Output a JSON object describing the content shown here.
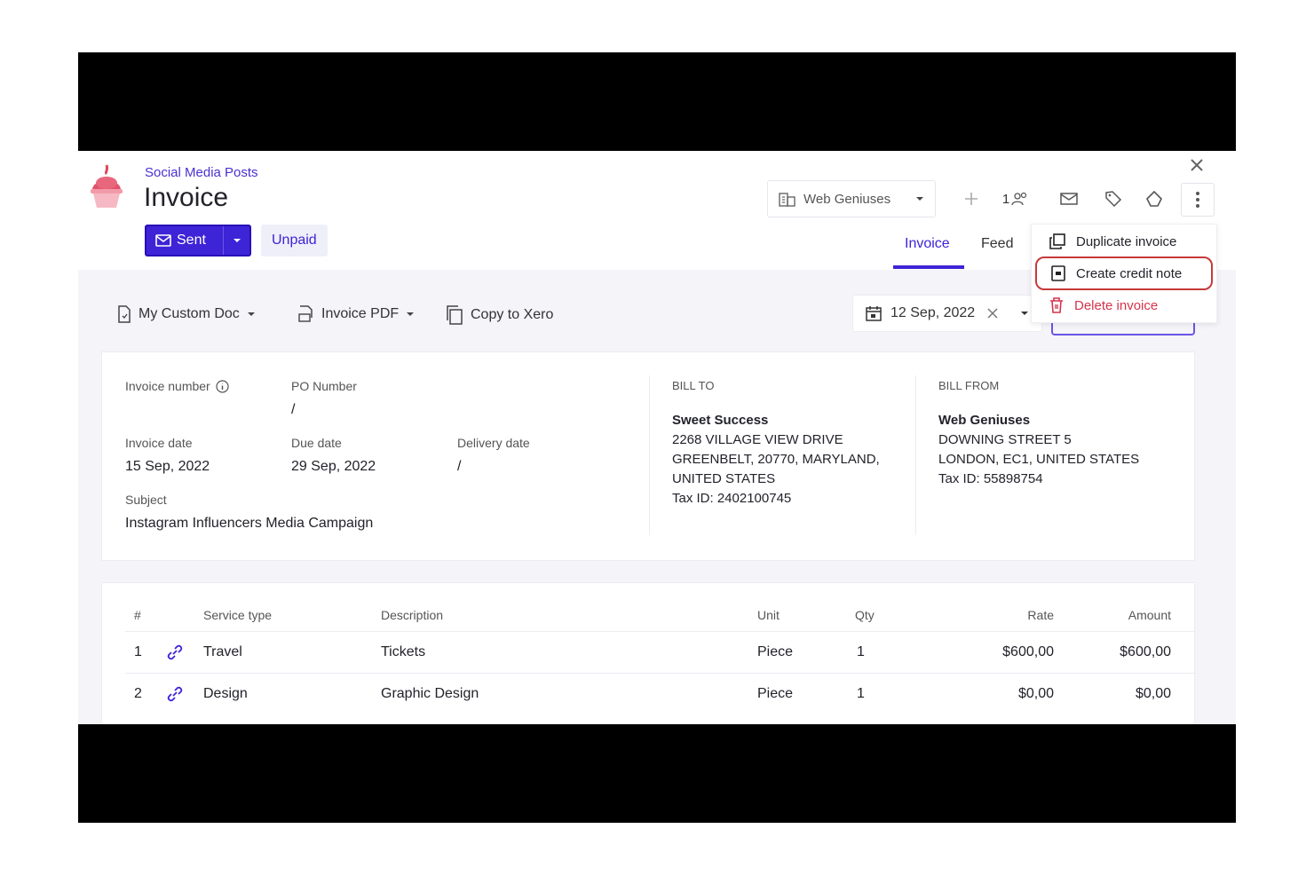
{
  "header": {
    "breadcrumb": "Social Media Posts",
    "title": "Invoice",
    "sent_label": "Sent",
    "status_badge": "Unpaid",
    "company": "Web Geniuses",
    "followers_count": "1",
    "tabs": [
      {
        "label": "Invoice"
      },
      {
        "label": "Feed"
      }
    ]
  },
  "menu": {
    "items": [
      {
        "label": "Duplicate invoice"
      },
      {
        "label": "Create credit note"
      },
      {
        "label": "Delete invoice"
      }
    ]
  },
  "actions": {
    "template": "My Custom Doc",
    "pdf": "Invoice PDF",
    "copy": "Copy to Xero",
    "date": "12 Sep, 2022"
  },
  "details": {
    "invoice_number_label": "Invoice number",
    "po_number_label": "PO Number",
    "po_number_value": "/",
    "invoice_date_label": "Invoice date",
    "invoice_date_value": "15 Sep, 2022",
    "due_date_label": "Due date",
    "due_date_value": "29 Sep, 2022",
    "delivery_date_label": "Delivery date",
    "delivery_date_value": "/",
    "subject_label": "Subject",
    "subject_value": "Instagram Influencers Media Campaign"
  },
  "bill_to": {
    "label": "BILL TO",
    "name": "Sweet Success",
    "line1": "2268 VILLAGE VIEW DRIVE",
    "line2": "GREENBELT, 20770, MARYLAND,",
    "line3": "UNITED STATES",
    "tax": "Tax ID: 2402100745"
  },
  "bill_from": {
    "label": "BILL FROM",
    "name": "Web Geniuses",
    "line1": "DOWNING STREET 5",
    "line2": "LONDON, EC1, UNITED STATES",
    "tax": "Tax ID: 55898754"
  },
  "table": {
    "headers": {
      "num": "#",
      "service": "Service type",
      "description": "Description",
      "unit": "Unit",
      "qty": "Qty",
      "rate": "Rate",
      "amount": "Amount"
    },
    "rows": [
      {
        "num": "1",
        "service": "Travel",
        "description": "Tickets",
        "unit": "Piece",
        "qty": "1",
        "rate": "$600,00",
        "amount": "$600,00"
      },
      {
        "num": "2",
        "service": "Design",
        "description": "Graphic Design",
        "unit": "Piece",
        "qty": "1",
        "rate": "$0,00",
        "amount": "$0,00"
      }
    ]
  },
  "colors": {
    "accent": "#3d24d6",
    "danger": "#d6334b",
    "highlight": "#c53a3a"
  }
}
